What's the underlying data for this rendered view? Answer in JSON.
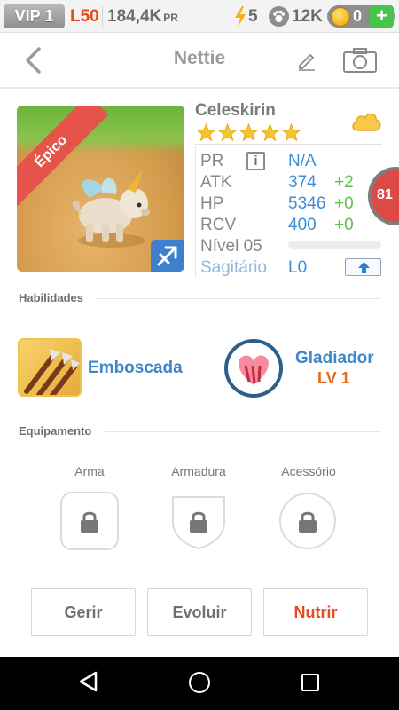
{
  "status": {
    "vip": "VIP 1",
    "level": "L50",
    "pr_value": "184,4K",
    "pr_unit": "PR",
    "energy": "5",
    "paws": "12K",
    "coins": "0",
    "add_label": "+"
  },
  "header": {
    "title": "Nettie",
    "back_icon": "chevron-left-icon",
    "edit_icon": "pencil-icon",
    "camera_icon": "camera-icon"
  },
  "pet": {
    "rarity": "Épico",
    "name": "Celeskirin",
    "stars": 5,
    "level_badge": "81",
    "sign": "Sagitário",
    "sign_level": "L0",
    "level_label": "Nível 05",
    "xp_fraction": 0.0,
    "stats": [
      {
        "label": "PR",
        "value": "N/A",
        "bonus": ""
      },
      {
        "label": "ATK",
        "value": "374",
        "bonus": "+2"
      },
      {
        "label": "HP",
        "value": "5346",
        "bonus": "+0"
      },
      {
        "label": "RCV",
        "value": "400",
        "bonus": "+0"
      }
    ],
    "info_label": "i"
  },
  "abilities": {
    "section_title": "Habilidades",
    "skill_name": "Emboscada",
    "trait_name": "Gladiador",
    "trait_level": "LV 1"
  },
  "equipment": {
    "section_title": "Equipamento",
    "slots": [
      "Arma",
      "Armadura",
      "Acessório"
    ]
  },
  "actions": {
    "manage": "Gerir",
    "evolve": "Evoluir",
    "feed": "Nutrir"
  },
  "colors": {
    "accent_blue": "#3e86c9",
    "bonus_green": "#5cc24c",
    "orange": "#e8491e",
    "epic_red": "#e5534b"
  }
}
